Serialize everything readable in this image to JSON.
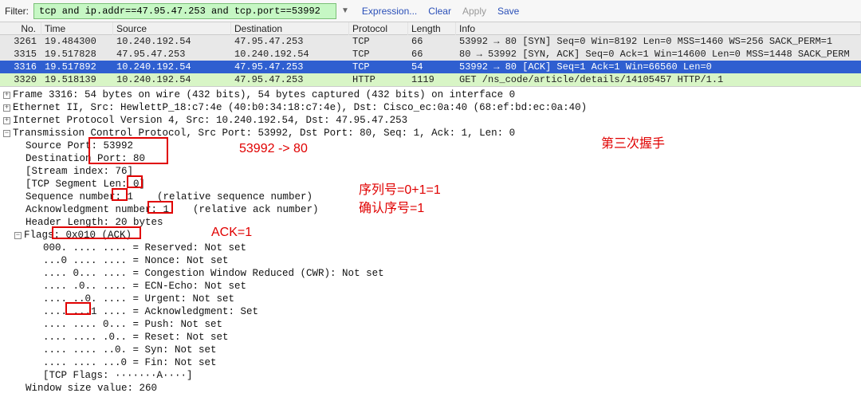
{
  "filter": {
    "label": "Filter:",
    "value": "tcp and ip.addr==47.95.47.253 and tcp.port==53992",
    "actions": {
      "expr": "Expression...",
      "clear": "Clear",
      "apply": "Apply",
      "save": "Save"
    }
  },
  "columns": [
    "No.",
    "Time",
    "Source",
    "Destination",
    "Protocol",
    "Length",
    "Info"
  ],
  "rows": [
    {
      "cls": "syn",
      "no": "3261",
      "time": "19.484300",
      "src": "10.240.192.54",
      "dst": "47.95.47.253",
      "proto": "TCP",
      "len": "66",
      "info": "53992 → 80 [SYN] Seq=0 Win=8192 Len=0 MSS=1460 WS=256 SACK_PERM=1"
    },
    {
      "cls": "syn",
      "no": "3315",
      "time": "19.517828",
      "src": "47.95.47.253",
      "dst": "10.240.192.54",
      "proto": "TCP",
      "len": "66",
      "info": "80 → 53992 [SYN, ACK] Seq=0 Ack=1 Win=14600 Len=0 MSS=1448 SACK_PERM"
    },
    {
      "cls": "selected",
      "no": "3316",
      "time": "19.517892",
      "src": "10.240.192.54",
      "dst": "47.95.47.253",
      "proto": "TCP",
      "len": "54",
      "info": "53992 → 80 [ACK] Seq=1 Ack=1 Win=66560 Len=0"
    },
    {
      "cls": "http",
      "no": "3320",
      "time": "19.518139",
      "src": "10.240.192.54",
      "dst": "47.95.47.253",
      "proto": "HTTP",
      "len": "1119",
      "info": "GET /ns_code/article/details/14105457 HTTP/1.1"
    }
  ],
  "details": {
    "frame": "Frame 3316: 54 bytes on wire (432 bits), 54 bytes captured (432 bits) on interface 0",
    "eth": "Ethernet II, Src: HewlettP_18:c7:4e (40:b0:34:18:c7:4e), Dst: Cisco_ec:0a:40 (68:ef:bd:ec:0a:40)",
    "ip": "Internet Protocol Version 4, Src: 10.240.192.54, Dst: 47.95.47.253",
    "tcp": "Transmission Control Protocol, Src Port: 53992, Dst Port: 80, Seq: 1, Ack: 1, Len: 0",
    "srcport": "Source Port: 53992",
    "dstport": "Destination Port: 80",
    "stream": "[Stream index: 76]",
    "seglen": "[TCP Segment Len: 0]",
    "seq": "Sequence number: 1    (relative sequence number)",
    "ack": "Acknowledgment number: 1    (relative ack number)",
    "hdrlen": "Header Length: 20 bytes",
    "flags": "Flags: 0x010 (ACK)",
    "f_res": "000. .... .... = Reserved: Not set",
    "f_nonce": "...0 .... .... = Nonce: Not set",
    "f_cwr": ".... 0... .... = Congestion Window Reduced (CWR): Not set",
    "f_ecn": ".... .0.. .... = ECN-Echo: Not set",
    "f_urg": ".... ..0. .... = Urgent: Not set",
    "f_ack": ".... ...1 .... = Acknowledgment: Set",
    "f_psh": ".... .... 0... = Push: Not set",
    "f_rst": ".... .... .0.. = Reset: Not set",
    "f_syn": ".... .... ..0. = Syn: Not set",
    "f_fin": ".... .... ...0 = Fin: Not set",
    "f_str": "[TCP Flags: ·······A····]",
    "win": "Window size value: 260"
  },
  "annotations": {
    "ports": "53992 -> 80",
    "handshake": "第三次握手",
    "seqlabel": "序列号=0+1=1",
    "acklabel": "确认序号=1",
    "ackflag": "ACK=1"
  }
}
